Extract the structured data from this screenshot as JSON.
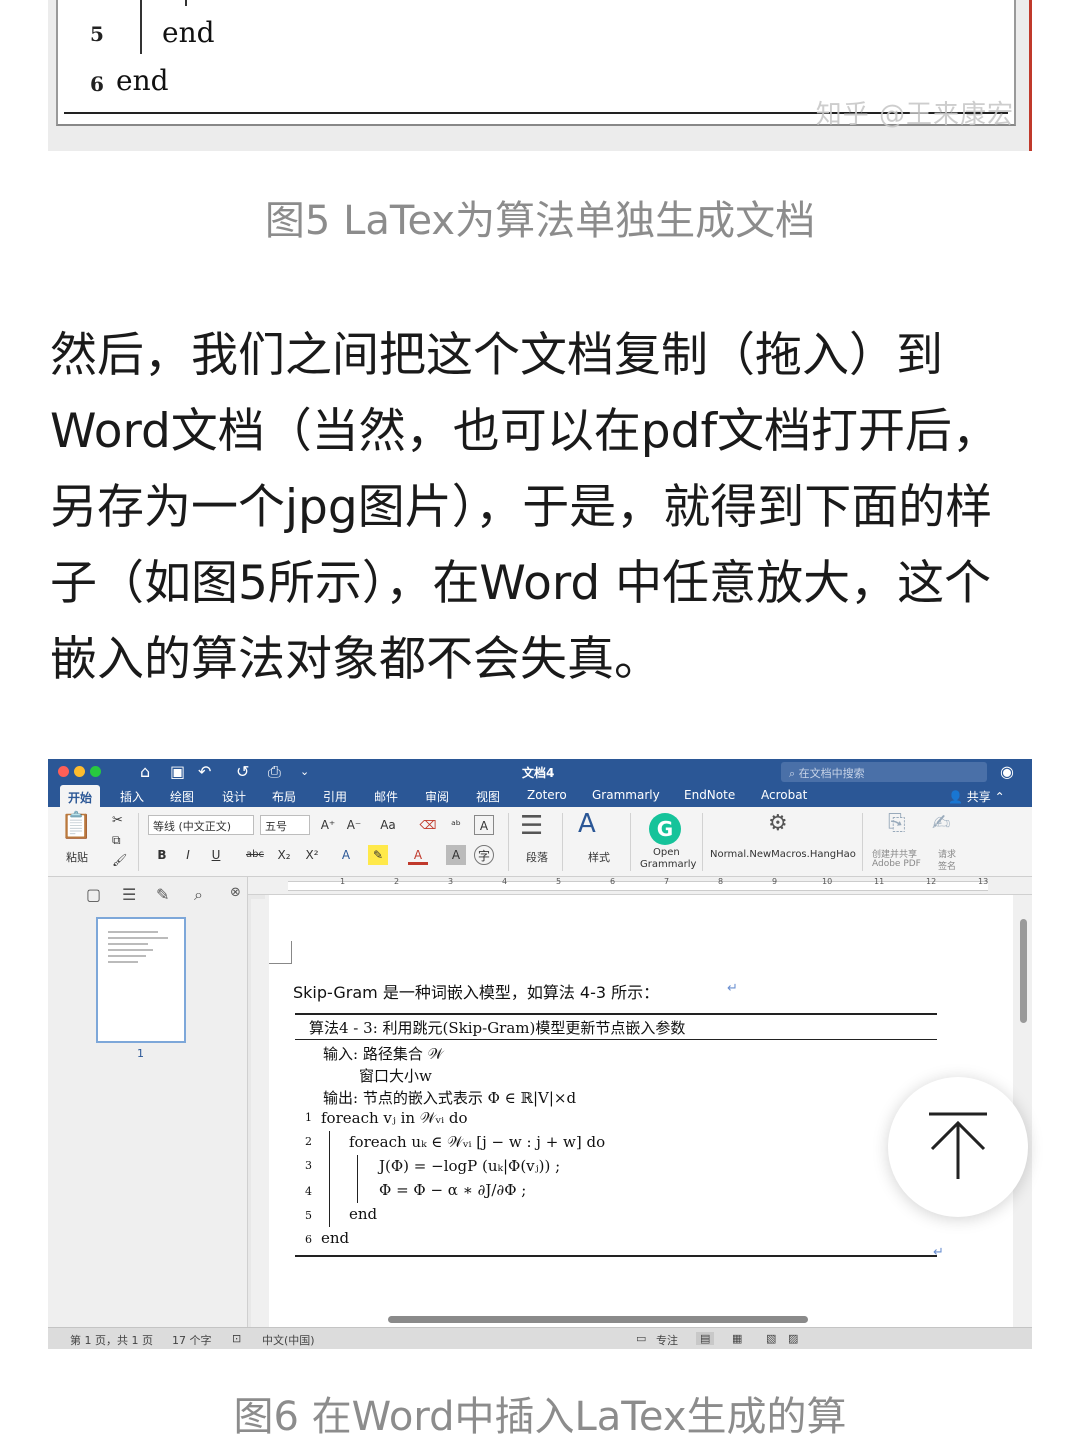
{
  "figure5": {
    "lines": [
      {
        "num": "5",
        "text": "end"
      },
      {
        "num": "6",
        "text": "end"
      }
    ],
    "watermark": "知乎 @王来康宏"
  },
  "caption5": "图5 LaTex为算法单独生成文档",
  "paragraph": [
    "然后，我们之间把这个文档复制（拖入）到",
    "Word文档（当然，也可以在pdf文档打开后，",
    "另存为一个jpg图片），于是，就得到下面的样",
    "子（如图5所示），在Word 中任意放大，这个",
    "嵌入的算法对象都不会失真。"
  ],
  "word": {
    "doc_title": "文档4",
    "search_placeholder": "在文档中搜索",
    "tabs": [
      "开始",
      "插入",
      "绘图",
      "设计",
      "布局",
      "引用",
      "邮件",
      "审阅",
      "视图",
      "Zotero",
      "Grammarly",
      "EndNote",
      "Acrobat"
    ],
    "share_label": "共享",
    "ribbon": {
      "paste_label": "粘贴",
      "font_name": "等线 (中文正文)",
      "font_size": "五号",
      "bold": "B",
      "italic": "I",
      "underline": "U",
      "strike": "abc",
      "sub": "X₂",
      "sup": "X²",
      "paragraph_label": "段落",
      "styles_label": "样式",
      "grammarly_label_1": "Open",
      "grammarly_label_2": "Grammarly",
      "macro_label": "Normal.NewMacros.HangHao",
      "adobe_label_1": "创建并共享",
      "adobe_label_2": "Adobe PDF",
      "sign_label_1": "请求",
      "sign_label_2": "签名"
    },
    "ruler_numbers": [
      "1",
      "2",
      "3",
      "4",
      "5",
      "6",
      "7",
      "8",
      "9",
      "10",
      "11",
      "12",
      "13"
    ],
    "thumb_page_num": "1",
    "document": {
      "intro": "Skip-Gram 是一种词嵌入模型，如算法 4-3 所示：",
      "alg_title": "算法4 - 3: 利用跳元(Skip-Gram)模型更新节点嵌入参数",
      "input_label": "输入: 路径集合 𝒲",
      "input_2": "窗口大小w",
      "output_label": "输出: 节点的嵌入式表示 Φ ∈ ℝ|V|×d",
      "steps": [
        {
          "num": "1",
          "text": "foreach vⱼ in 𝒲ᵥᵢ do"
        },
        {
          "num": "2",
          "text": "foreach uₖ ∈ 𝒲ᵥᵢ [j − w : j + w] do"
        },
        {
          "num": "3",
          "text": "J(Φ) = −logP (uₖ|Φ(vⱼ)) ;"
        },
        {
          "num": "4",
          "text": "Φ = Φ − α ∗ ∂J/∂Φ ;"
        },
        {
          "num": "5",
          "text": "end"
        },
        {
          "num": "6",
          "text": "end"
        }
      ]
    },
    "status": {
      "page": "第 1 页，共 1 页",
      "words": "17 个字",
      "lang": "中文(中国)",
      "focus": "专注"
    },
    "colors": {
      "titlebar": "#2b5796",
      "grammarly": "#15c39a"
    }
  },
  "caption6": "图6 在Word中插入LaTex生成的算"
}
